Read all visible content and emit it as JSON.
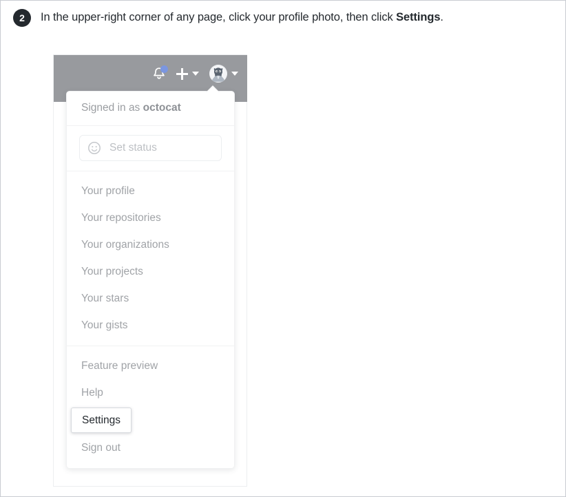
{
  "instruction": {
    "step_number": "2",
    "text_before": "In the upper-right corner of any page, click your profile photo, then click ",
    "emphasis": "Settings",
    "text_after": "."
  },
  "screenshot": {
    "header": {
      "background_color": "#989a9e",
      "icons": [
        {
          "name": "notifications-bell-icon",
          "has_unread_dot": true,
          "dot_color": "#7b96e0"
        },
        {
          "name": "create-new-icon",
          "label": "+",
          "has_caret": true
        },
        {
          "name": "profile-avatar",
          "label": "octocat",
          "has_caret": true
        }
      ]
    },
    "dropdown": {
      "signed_in_prefix": "Signed in as",
      "signed_in_user": "octocat",
      "status_button": {
        "icon": "smiley-icon",
        "placeholder": "Set status"
      },
      "menu_group_1": [
        {
          "label": "Your profile"
        },
        {
          "label": "Your repositories"
        },
        {
          "label": "Your organizations"
        },
        {
          "label": "Your projects"
        },
        {
          "label": "Your stars"
        },
        {
          "label": "Your gists"
        }
      ],
      "menu_group_2": [
        {
          "label": "Feature preview",
          "highlighted": false
        },
        {
          "label": "Help",
          "highlighted": false
        },
        {
          "label": "Settings",
          "highlighted": true
        },
        {
          "label": "Sign out",
          "highlighted": false
        }
      ]
    }
  }
}
